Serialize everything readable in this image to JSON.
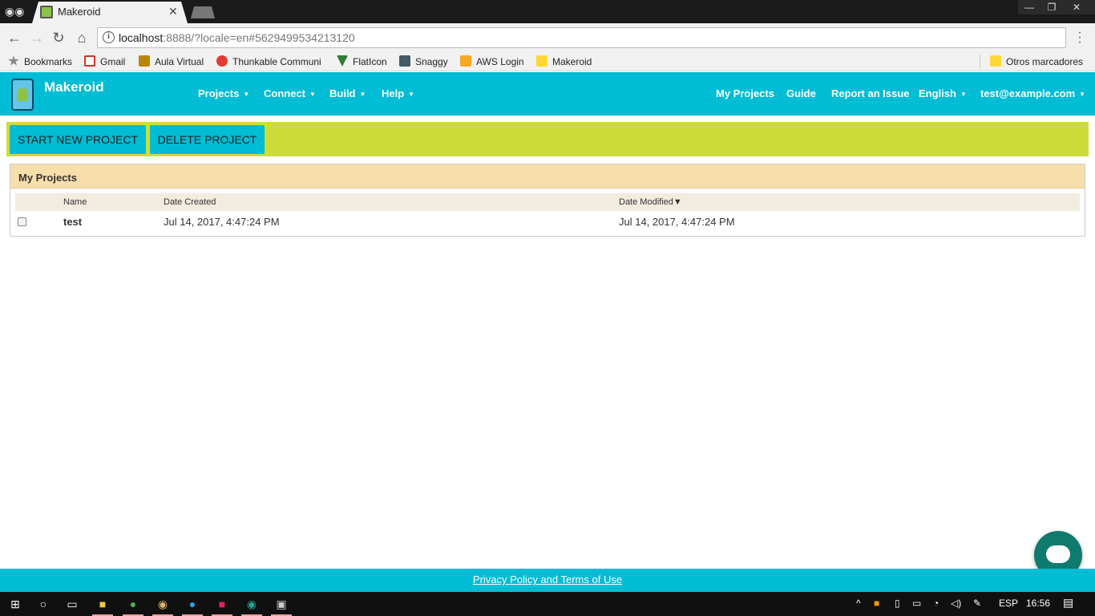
{
  "browser": {
    "tab_title": "Makeroid",
    "url_host": "localhost",
    "url_rest": ":8888/?locale=en#5629499534213120",
    "bookmarks": [
      {
        "label": "Bookmarks",
        "color": "#888888"
      },
      {
        "label": "Gmail",
        "color": "#d93025"
      },
      {
        "label": "Aula Virtual",
        "color": "#b8860b"
      },
      {
        "label": "Thunkable Communi",
        "color": "#e53935"
      },
      {
        "label": "FlatIcon",
        "color": "#2e7d32"
      },
      {
        "label": "Snaggy",
        "color": "#455a64"
      },
      {
        "label": "AWS Login",
        "color": "#f9a825"
      },
      {
        "label": "Makeroid",
        "color": "#fdd835"
      }
    ],
    "other_bookmarks": "Otros marcadores"
  },
  "app": {
    "brand": "Makeroid",
    "nav": [
      "Projects",
      "Connect",
      "Build",
      "Help"
    ],
    "right_nav": {
      "my_projects": "My Projects",
      "guide": "Guide",
      "report": "Report an Issue",
      "language": "English",
      "user": "test@example.com"
    },
    "actions": {
      "start": "START NEW PROJECT",
      "delete": "DELETE PROJECT"
    },
    "panel_title": "My Projects",
    "columns": {
      "name": "Name",
      "created": "Date Created",
      "modified": "Date Modified",
      "sort_indicator": "▼"
    },
    "rows": [
      {
        "name": "test",
        "created": "Jul 14, 2017, 4:47:24 PM",
        "modified": "Jul 14, 2017, 4:47:24 PM"
      }
    ],
    "footer_link": "Privacy Policy and Terms of Use",
    "colors": {
      "primary": "#00bcd4",
      "action_bar": "#cddc39",
      "panel_head": "#f8deaa"
    }
  },
  "taskbar": {
    "language": "ESP",
    "time": "16:56"
  }
}
